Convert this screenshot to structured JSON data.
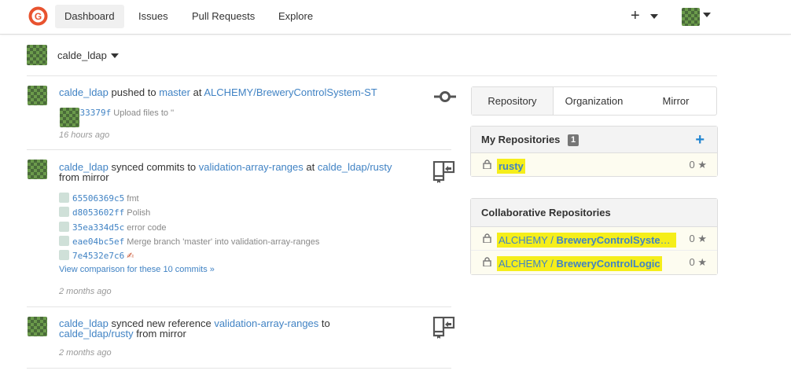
{
  "nav": {
    "items": [
      "Dashboard",
      "Issues",
      "Pull Requests",
      "Explore"
    ],
    "plus_label": "+"
  },
  "context": {
    "user": "calde_ldap"
  },
  "feed": [
    {
      "user": "calde_ldap",
      "action": "pushed to",
      "branch": "master",
      "at": "at",
      "repo": "ALCHEMY/BreweryControlSystem-ST",
      "commits": [
        {
          "sha": "192033379f",
          "msg": "Upload files to ''"
        }
      ],
      "time": "16 hours ago"
    },
    {
      "user": "calde_ldap",
      "action": "synced commits to",
      "branch": "validation-array-ranges",
      "at": "at",
      "repo": "calde_ldap/rusty",
      "tail": "from mirror",
      "commits": [
        {
          "sha": "65506369c5",
          "msg": "fmt"
        },
        {
          "sha": "d8053602ff",
          "msg": "Polish"
        },
        {
          "sha": "35ea334d5c",
          "msg": "error code"
        },
        {
          "sha": "eae04bc5ef",
          "msg": "Merge branch 'master' into validation-array-ranges"
        },
        {
          "sha": "7e4532e7c6",
          "msg": "✍"
        }
      ],
      "compare": "View comparison for these 10 commits »",
      "time": "2 months ago"
    },
    {
      "user": "calde_ldap",
      "action": "synced new reference",
      "branch": "validation-array-ranges",
      "at": "to",
      "repo": "calde_ldap/rusty",
      "tail": "from mirror",
      "time": "2 months ago"
    }
  ],
  "tabs": [
    "Repository",
    "Organization",
    "Mirror"
  ],
  "my_repos": {
    "title": "My Repositories",
    "count": "1",
    "items": [
      {
        "owner": "",
        "name": "rusty",
        "stars": "0"
      }
    ]
  },
  "collab_repos": {
    "title": "Collaborative Repositories",
    "items": [
      {
        "owner": "ALCHEMY / ",
        "name": "BreweryControlSystem-ST",
        "stars": "0"
      },
      {
        "owner": "ALCHEMY / ",
        "name": "BreweryControlLogic",
        "stars": "0"
      }
    ]
  },
  "colors": {
    "link": "#4183c4",
    "highlight": "#f5ee1a",
    "add": "#2185d0"
  }
}
